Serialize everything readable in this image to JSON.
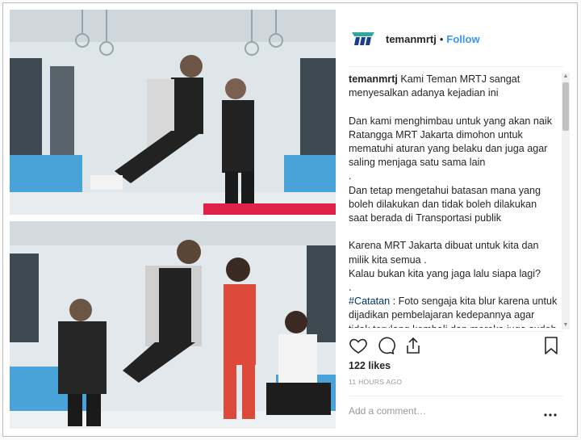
{
  "post": {
    "username": "temanmrtj",
    "follow_label": "Follow",
    "separator": "•",
    "caption": {
      "username": "temanmrtj",
      "intro": " Kami Teman MRTJ sangat menyesalkan adanya kejadian ini",
      "p2": "Dan kami menghimbau untuk yang akan naik Ratangga MRT Jakarta dimohon untuk mematuhi aturan yang belaku dan juga agar saling menjaga satu sama lain",
      "dot1": ".",
      "p3": "Dan tetap mengetahui batasan mana yang boleh dilakukan dan tidak boleh dilakukan saat berada di Transportasi publik",
      "p4": "Karena MRT Jakarta dibuat untuk kita dan milik kita semua .",
      "p5": "Kalau bukan kita yang jaga lalu siapa lagi?",
      "dot2": ".",
      "hashtag": "#Catatan",
      "p6": " : Foto sengaja kita blur karena untuk dijadikan pembelajaran kedepannya agar tidak terulang kembali dan mereka juga sudah menyampaikan permintaan"
    },
    "likes": "122 likes",
    "timestamp": "11 HOURS AGO",
    "comment_placeholder": "Add a comment…"
  },
  "icons": {
    "heart": "heart-icon",
    "comment": "comment-icon",
    "share": "share-icon",
    "bookmark": "bookmark-icon",
    "more": "more-icon"
  },
  "colors": {
    "follow": "#3897f0",
    "hashtag": "#003569",
    "logo_teal": "#2ea7a3",
    "logo_navy": "#1d3d8f"
  }
}
